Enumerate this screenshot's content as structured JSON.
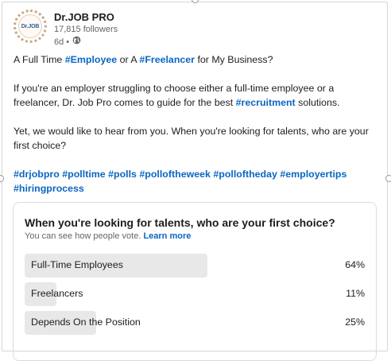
{
  "author": {
    "logo_text": "Dr.JOB",
    "name": "Dr.JOB PRO",
    "followers": "17,815 followers",
    "time": "6d •",
    "visibility_icon": "globe-icon"
  },
  "post": {
    "line1": {
      "pre": "A Full Time ",
      "tag1": "#Employee",
      "mid": " or A ",
      "tag2": "#Freelancer",
      "post": " for My Business?"
    },
    "para2": {
      "pre": "If you're an employer struggling to choose either a full-time employee or a freelancer, Dr. Job Pro comes to guide for the best ",
      "tag": "#recruitment",
      "post": " solutions."
    },
    "para3": "Yet, we would like to hear from you. When you're looking for talents, who are your first choice?",
    "hashtags": [
      "#drjobpro",
      "#polltime",
      "#polls",
      "#polloftheweek",
      "#polloftheday",
      "#employertips",
      "#hiringprocess"
    ]
  },
  "poll": {
    "question": "When you're looking for talents, who are your first choice?",
    "note": "You can see how people vote.",
    "learn_more": "Learn more",
    "options": [
      {
        "label": "Full-Time Employees",
        "percent": 64,
        "percent_text": "64%"
      },
      {
        "label": "Freelancers",
        "percent": 11,
        "percent_text": "11%"
      },
      {
        "label": "Depends On the Position",
        "percent": 25,
        "percent_text": "25%"
      }
    ]
  },
  "colors": {
    "link": "#0a66c2",
    "bar": "#e8e8e8"
  }
}
